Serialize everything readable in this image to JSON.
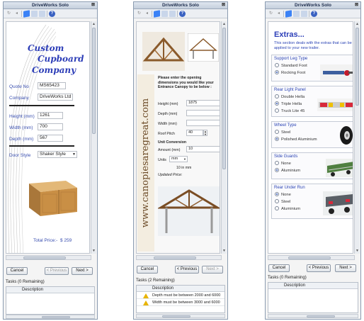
{
  "app": {
    "title": "DriveWorks Solo"
  },
  "common": {
    "cancel": "Cancel",
    "previous": "< Previous",
    "next": "Next >",
    "description": "Description"
  },
  "panel1": {
    "company_line1": "Custom",
    "company_line2": "Cupboard",
    "company_line3": "Company",
    "quote_label": "Quote No",
    "quote_value": "MS65423",
    "company_label": "Company",
    "company_value": "DriveWorks Ltd",
    "height_label": "Height (mm)",
    "height_value": "1261",
    "width_label": "Width (mm)",
    "width_value": "700",
    "depth_label": "Depth (mm)",
    "depth_value": "567",
    "door_label": "Door Style",
    "door_value": "Shaker Style",
    "total_label": "Total Price:-",
    "total_value": "$ 259",
    "tasks": "Tasks (0 Remaining)"
  },
  "panel2": {
    "vertical_text": "www.canopiesaregreat.com",
    "instructions": "Please enter the opening dimensions you would like your Entrance Canopy to be below :",
    "height_label": "Height (mm)",
    "height_value": "1875",
    "depth_label": "Depth (mm)",
    "width_label": "Width (mm)",
    "roof_label": "Roof Pitch",
    "roof_value": "40",
    "unit_heading": "Unit Conversion",
    "amount_label": "Amount (mm)",
    "amount_value": "10",
    "units_label": "Units",
    "units_value": "mm",
    "units_result": "10 in mm",
    "updated_price": "Updated Price:",
    "tasks": "Tasks (2 Remaining)",
    "task1": "Depth must be between 2000 and 6000",
    "task2": "Width must be between 3000 and 6000"
  },
  "panel3": {
    "title": "Extras...",
    "subtitle": "This section deals with the extras that can be applied to your new trailer.",
    "groups": [
      {
        "title": "Support Leg Type",
        "options": [
          "Standard Foot",
          "Rocking Foot"
        ],
        "selected": 1
      },
      {
        "title": "Rear Light Panel",
        "options": [
          "Double Hella",
          "Triple Hella",
          "Truck Lite 45"
        ],
        "selected": 1
      },
      {
        "title": "Wheel Type",
        "options": [
          "Steel",
          "Polished Aluminium"
        ],
        "selected": 1
      },
      {
        "title": "Side Guards",
        "options": [
          "None",
          "Aluminium"
        ],
        "selected": 1
      },
      {
        "title": "Rear Under Run",
        "options": [
          "None",
          "Steel",
          "Aluminium"
        ],
        "selected": 0
      }
    ],
    "tasks": "Tasks (0 Remaining)"
  }
}
